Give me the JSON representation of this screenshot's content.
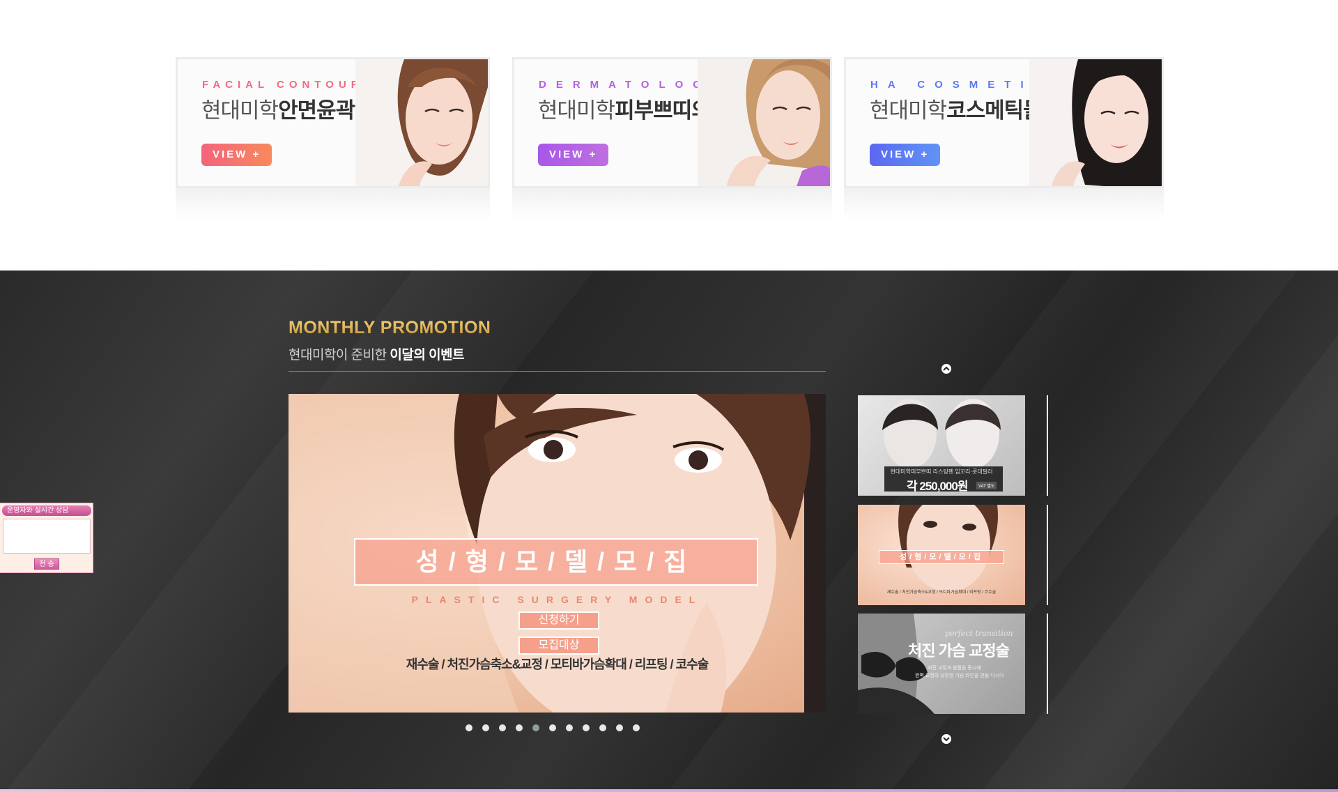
{
  "banners": [
    {
      "eng": "FACIAL CONTOURING",
      "kor_prefix": "현대미학",
      "kor_bold": "안면윤곽센터",
      "view_label": "VIEW +",
      "accent": "#f16b82"
    },
    {
      "eng": "DERMATOLOGY",
      "kor_prefix": "현대미학",
      "kor_bold": "피부쁘띠의원",
      "view_label": "VIEW +",
      "accent": "#b45fe4"
    },
    {
      "eng": "HA COSMETICS",
      "kor_prefix": "현대미학",
      "kor_bold": "코스메틱몰",
      "view_label": "VIEW +",
      "accent": "#5f79f4"
    }
  ],
  "promotion": {
    "title": "MONTHLY PROMOTION",
    "subtitle_prefix": "현대미학이 준비한",
    "subtitle_bold": "이달의 이벤트",
    "main_slide": {
      "title": "성/형/모/델/모/집",
      "eng": "PLASTIC SURGERY MODEL",
      "btn_apply": "신청하기",
      "btn_target": "모집대상",
      "list": "재수술 / 처진가슴축소&교정 / 모티바가슴확대 / 리프팅 / 코수술"
    },
    "dots_total": 11,
    "dots_active": 5,
    "thumbs": [
      {
        "caption": "현대미학피부쁘띠 리스팅펜 입꼬리·콧대필러",
        "price": "각 250,000원",
        "badge": "VAT 별도"
      },
      {
        "title": "성/형/모/델/모/집",
        "caption": "재수술 / 처진가슴축소&교정 / 모티바가슴확대 / 리프팅 / 코수술"
      },
      {
        "script": "perfect transition",
        "title": "처진 가슴 교정술",
        "caption1": "처진 교정과 볼륨을 동시에",
        "caption2": "완벽 교정의 상징한 가슴 라인을 만들 다시다"
      }
    ],
    "arrow_up": "chevron-up-icon",
    "arrow_down": "chevron-down-icon"
  },
  "chat": {
    "title": "운영자와 실시간 상담",
    "message_value": "",
    "send_label": "전 송"
  },
  "colors": {
    "gold": "#e1b450",
    "dark_bg": "#2d2d2d",
    "dot_active": "#8f9f97"
  }
}
